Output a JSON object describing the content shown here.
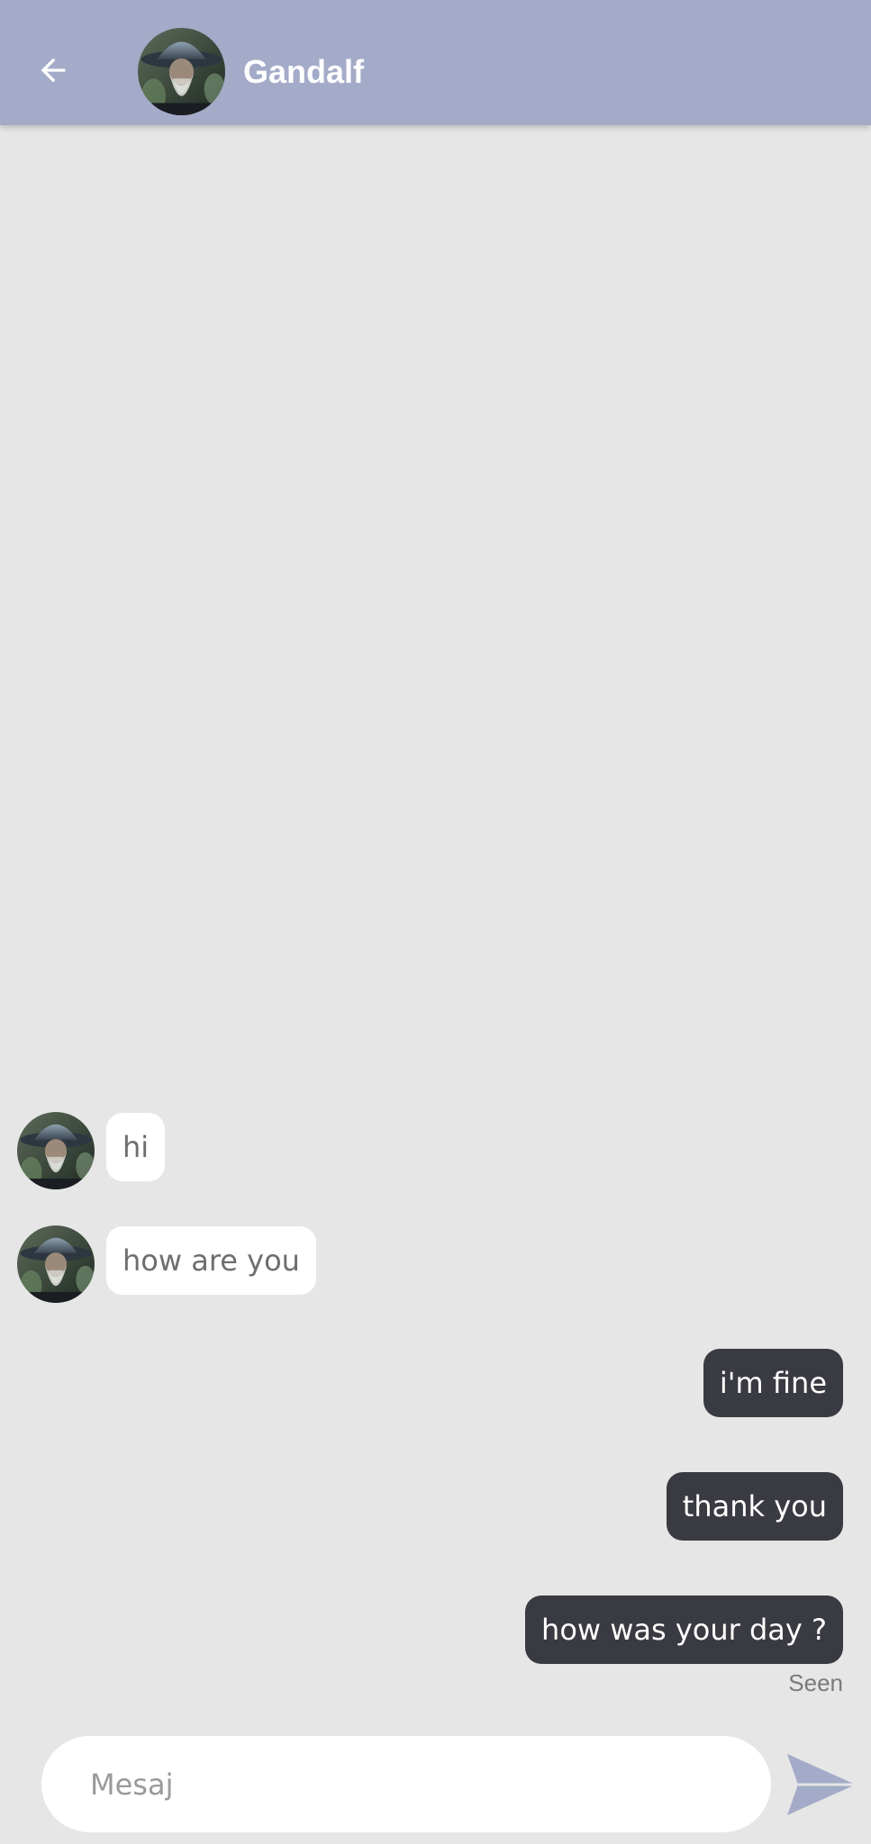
{
  "header": {
    "title": "Gandalf",
    "background": "#a3abc8"
  },
  "messages": [
    {
      "direction": "incoming",
      "text": "hi"
    },
    {
      "direction": "incoming",
      "text": "how are you"
    },
    {
      "direction": "outgoing",
      "text": "i'm fine"
    },
    {
      "direction": "outgoing",
      "text": "thank you"
    },
    {
      "direction": "outgoing",
      "text": "how was your day ?"
    }
  ],
  "status": {
    "seen_label": "Seen"
  },
  "composer": {
    "placeholder": "Mesaj",
    "value": ""
  },
  "icons": {
    "back": "arrow-left-icon",
    "send": "send-icon"
  },
  "colors": {
    "background": "#e6e6e6",
    "incoming_bubble": "#ffffff",
    "outgoing_bubble": "#393a42",
    "accent": "#a3abc8"
  }
}
